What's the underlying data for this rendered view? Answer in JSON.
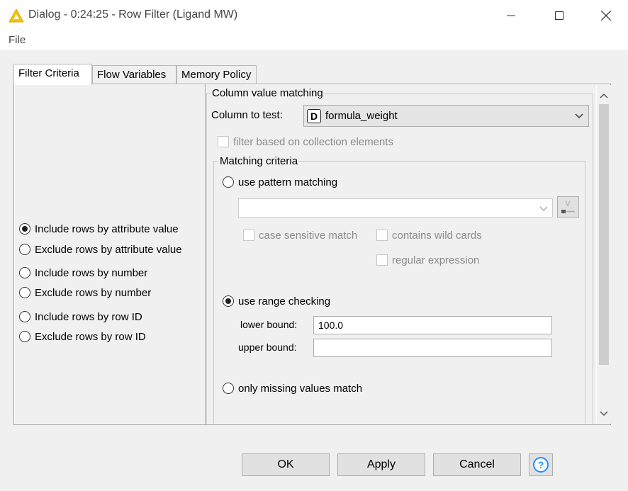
{
  "window": {
    "title": "Dialog - 0:24:25 - Row Filter (Ligand MW)",
    "app_icon": "knime-triangle-icon",
    "controls": [
      "minimize-icon",
      "maximize-icon",
      "close-icon"
    ]
  },
  "menubar": {
    "file_label": "File"
  },
  "tabs": [
    {
      "label": "Filter Criteria",
      "active": true
    },
    {
      "label": "Flow Variables",
      "active": false
    },
    {
      "label": "Memory Policy",
      "active": false
    }
  ],
  "filter_mode": {
    "options": [
      {
        "label": "Include rows by attribute value",
        "checked": true
      },
      {
        "label": "Exclude rows by attribute value",
        "checked": false
      },
      {
        "label": "Include rows by number",
        "checked": false
      },
      {
        "label": "Exclude rows by number",
        "checked": false
      },
      {
        "label": "Include rows by row ID",
        "checked": false
      },
      {
        "label": "Exclude rows by row ID",
        "checked": false
      }
    ]
  },
  "column_matching": {
    "group_title": "Column value matching",
    "column_label": "Column to test:",
    "column_type": "D",
    "column_value": "formula_weight",
    "collection_label": "filter based on collection elements",
    "matching_title": "Matching criteria",
    "pattern_label": "use pattern matching",
    "pattern_value": "",
    "case_sensitive_label": "case sensitive match",
    "wild_cards_label": "contains wild cards",
    "regex_label": "regular expression",
    "range_label": "use range checking",
    "lower_label": "lower bound:",
    "lower_value": "100.0",
    "upper_label": "upper bound:",
    "upper_value": "",
    "missing_label": "only missing values match",
    "selected_mode": "range"
  },
  "buttons": {
    "ok": "OK",
    "apply": "Apply",
    "cancel": "Cancel",
    "help_icon": "help-question-icon"
  },
  "colors": {
    "help_accent": "#1e90ff",
    "knime_yellow": "#f5c400"
  }
}
